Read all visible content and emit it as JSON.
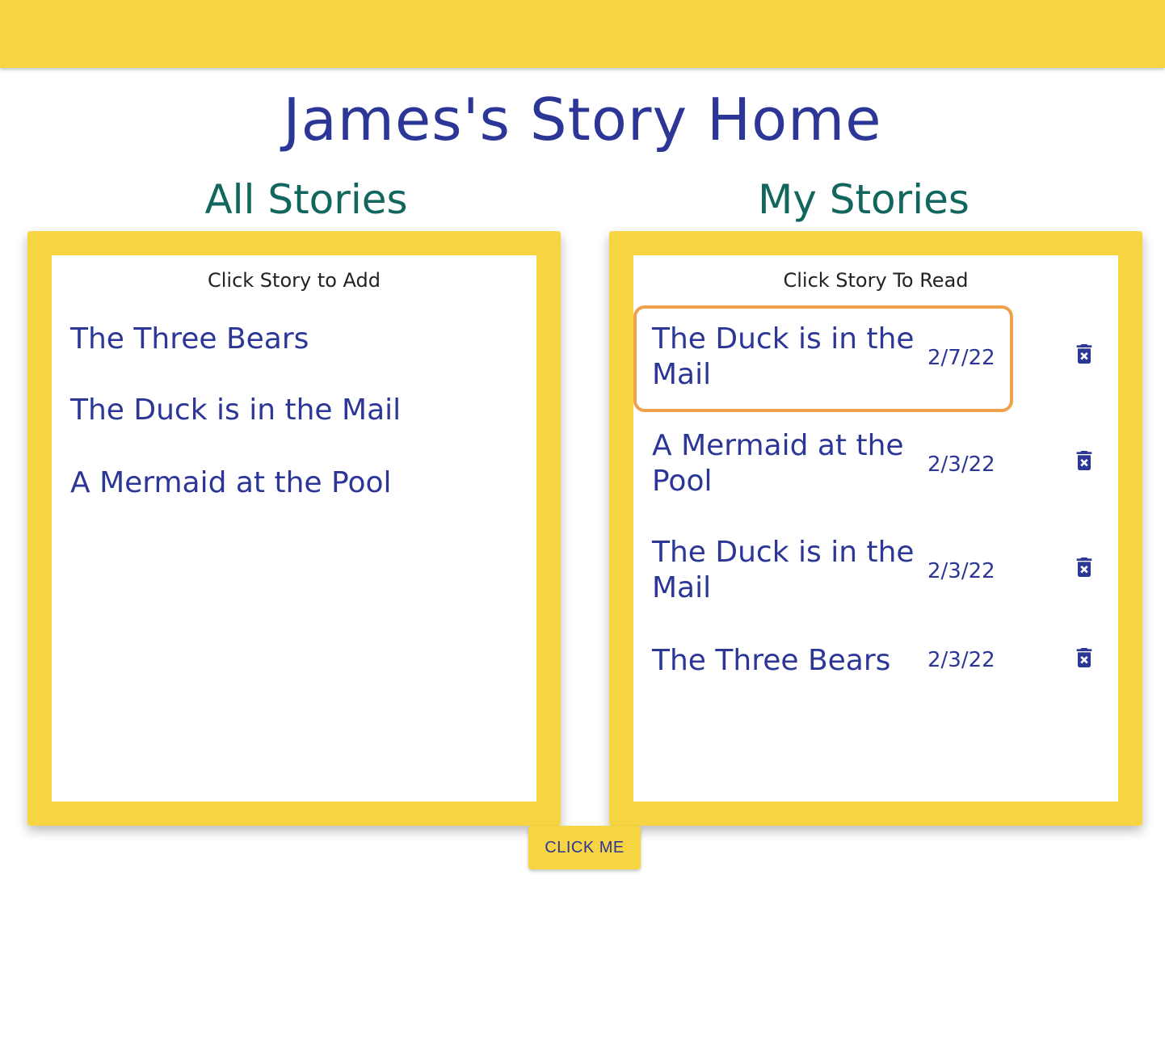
{
  "colors": {
    "accent_yellow": "#f7d442",
    "title_blue": "#2c3696",
    "heading_teal": "#11665e",
    "focus_orange": "#f0a04b",
    "caption_text": "#222222"
  },
  "header": {
    "title": "James's Story Home"
  },
  "all_stories": {
    "heading": "All Stories",
    "caption": "Click Story to Add",
    "items": [
      {
        "title": "The Three Bears"
      },
      {
        "title": "The Duck is in the Mail"
      },
      {
        "title": "A Mermaid at the Pool"
      }
    ]
  },
  "my_stories": {
    "heading": "My Stories",
    "caption": "Click Story To Read",
    "items": [
      {
        "title": "The Duck is in the Mail",
        "date": "2/7/22",
        "focused": true,
        "delete_icon": "trash-x-icon"
      },
      {
        "title": "A Mermaid at the Pool",
        "date": "2/3/22",
        "delete_icon": "trash-x-icon"
      },
      {
        "title": "The Duck is in the Mail",
        "date": "2/3/22",
        "delete_icon": "trash-x-icon"
      },
      {
        "title": "The Three Bears",
        "date": "2/3/22",
        "delete_icon": "trash-x-icon"
      }
    ]
  },
  "action_button": {
    "label": "CLICK ME"
  }
}
